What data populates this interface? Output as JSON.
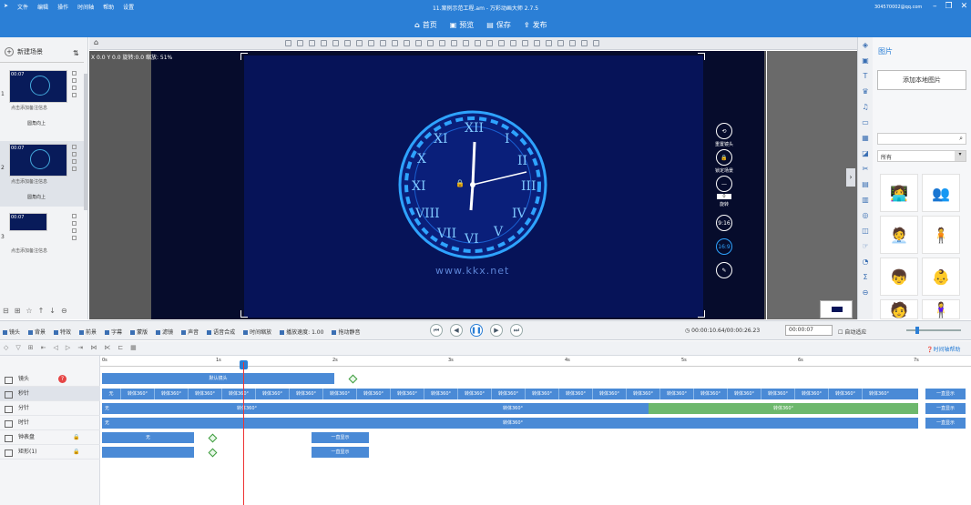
{
  "titlebar": {
    "menu": [
      "文件",
      "编辑",
      "操作",
      "时间轴",
      "帮助",
      "设置"
    ],
    "title": "11.案例示范工程.am - 万彩动画大师 2.7.5",
    "actions": {
      "home": "首页",
      "preview": "预览",
      "save": "保存",
      "publish": "发布"
    },
    "account": "304570002@qq.com"
  },
  "canvas": {
    "info": "X 0.0  Y 0.0  旋转:0.0  缩放: 51%",
    "watermark": "www.kkx.net"
  },
  "scenes": {
    "new_label": "新建场景",
    "items": [
      {
        "num": "1",
        "time": "00:07",
        "note": "点击添加备注信息",
        "anim": "圆角向上"
      },
      {
        "num": "2",
        "time": "00:07",
        "note": "点击添加备注信息",
        "anim": "圆角向上"
      },
      {
        "num": "3",
        "time": "00:07",
        "note": "点击添加备注信息",
        "anim": ""
      }
    ]
  },
  "vtools": {
    "lock_camera": "重置镜头",
    "lock_scene": "锁定场景",
    "rotate": "旋转",
    "rotate_val": "0",
    "ratio1": "9:16",
    "ratio2": "16:9"
  },
  "library": {
    "header": "图片",
    "add_local": "添加本地图片",
    "filter": "所有"
  },
  "timeline_tools": [
    "镜头",
    "背景",
    "特效",
    "前景",
    "字幕",
    "蒙版",
    "滤镜",
    "声音",
    "语音合成",
    "时间缩放",
    "播放速度: 1.00",
    "拖动静音"
  ],
  "time": {
    "current": "00:00:10.64/00:00:26.23",
    "input": "00:00:07",
    "auto_zoom": "自动适应"
  },
  "help_label": "时间轴帮助",
  "ruler": [
    "0s",
    "1s",
    "2s",
    "3s",
    "4s",
    "5s",
    "6s",
    "7s"
  ],
  "tracks": [
    {
      "name": "镜头"
    },
    {
      "name": "秒针"
    },
    {
      "name": "分针"
    },
    {
      "name": "时针"
    },
    {
      "name": "钟表盘"
    },
    {
      "name": "矩形(1)"
    }
  ],
  "bars": {
    "camera": "默认镜头",
    "seconds_start": "无",
    "seconds_seg": "转体360°",
    "minutes_start": "无",
    "minutes_mid": "转体360°",
    "hours_start": "无",
    "hours_mid": "转体360°",
    "always": "一直显示",
    "none": "无",
    "always2": "一直显示",
    "always3": "一直显示"
  },
  "colors": {
    "accent": "#2b7fd6",
    "stage": "#061358",
    "clock": "#2ea3ff"
  }
}
